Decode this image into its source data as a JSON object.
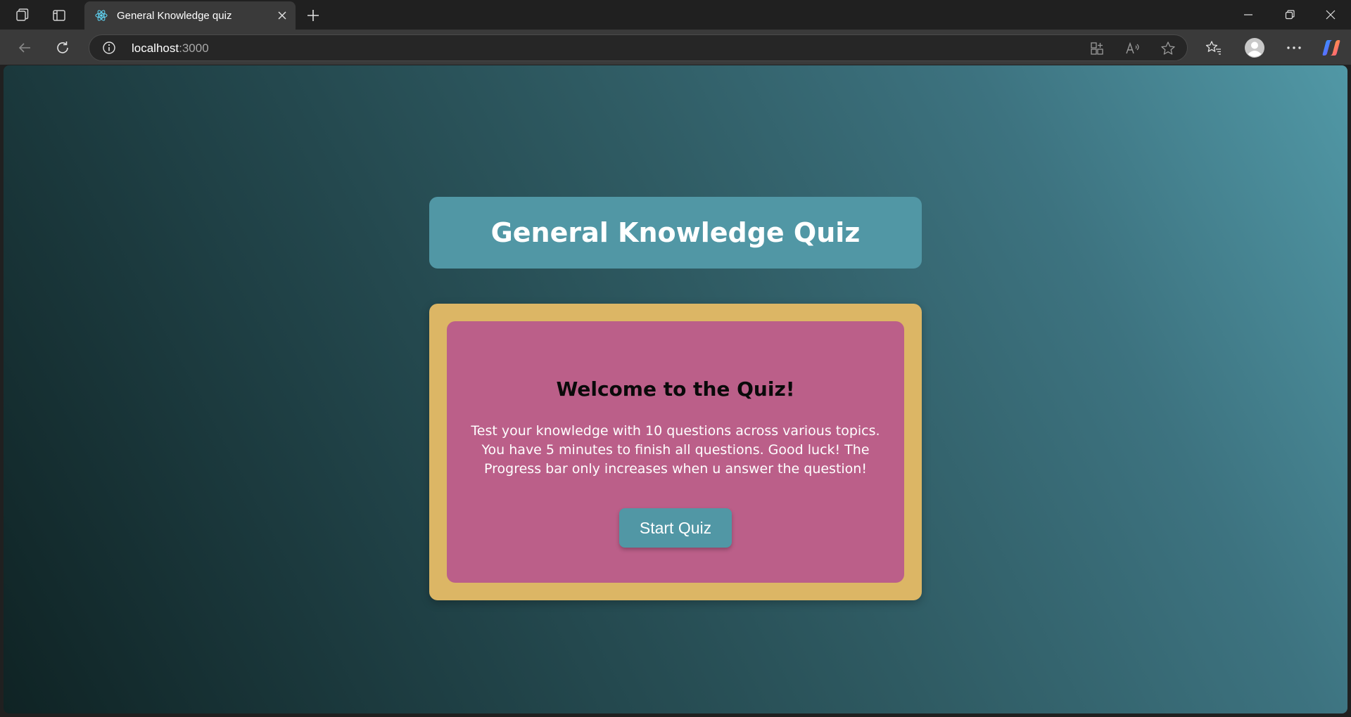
{
  "browser": {
    "tab_title": "General Knowledge quiz",
    "address_host": "localhost",
    "address_port": ":3000",
    "icons": {
      "workspaces": "workspaces-icon",
      "tab_actions": "tab-actions-icon",
      "favicon": "react-icon",
      "close_tab": "close-icon",
      "new_tab": "plus-icon",
      "minimize": "minimize-icon",
      "restore": "restore-icon",
      "close_window": "close-icon",
      "back": "back-arrow-icon",
      "refresh": "refresh-icon",
      "site_info": "info-icon",
      "apps": "apps-icon",
      "read_aloud": "read-aloud-icon",
      "favorite": "star-icon",
      "favorites": "favorites-icon",
      "profile": "profile-icon",
      "more": "more-icon",
      "copilot": "copilot-icon"
    }
  },
  "page": {
    "title": "General Knowledge Quiz",
    "welcome_heading": "Welcome to the Quiz!",
    "description": "Test your knowledge with 10 questions across various topics. You have 5 minutes to finish all questions. Good luck! The Progress bar only increases when u answer the question!",
    "start_button": "Start Quiz"
  },
  "colors": {
    "title_box": "#5197a5",
    "card_border": "#dcb665",
    "card_inner": "#bb5f89",
    "button": "#5197a5"
  }
}
